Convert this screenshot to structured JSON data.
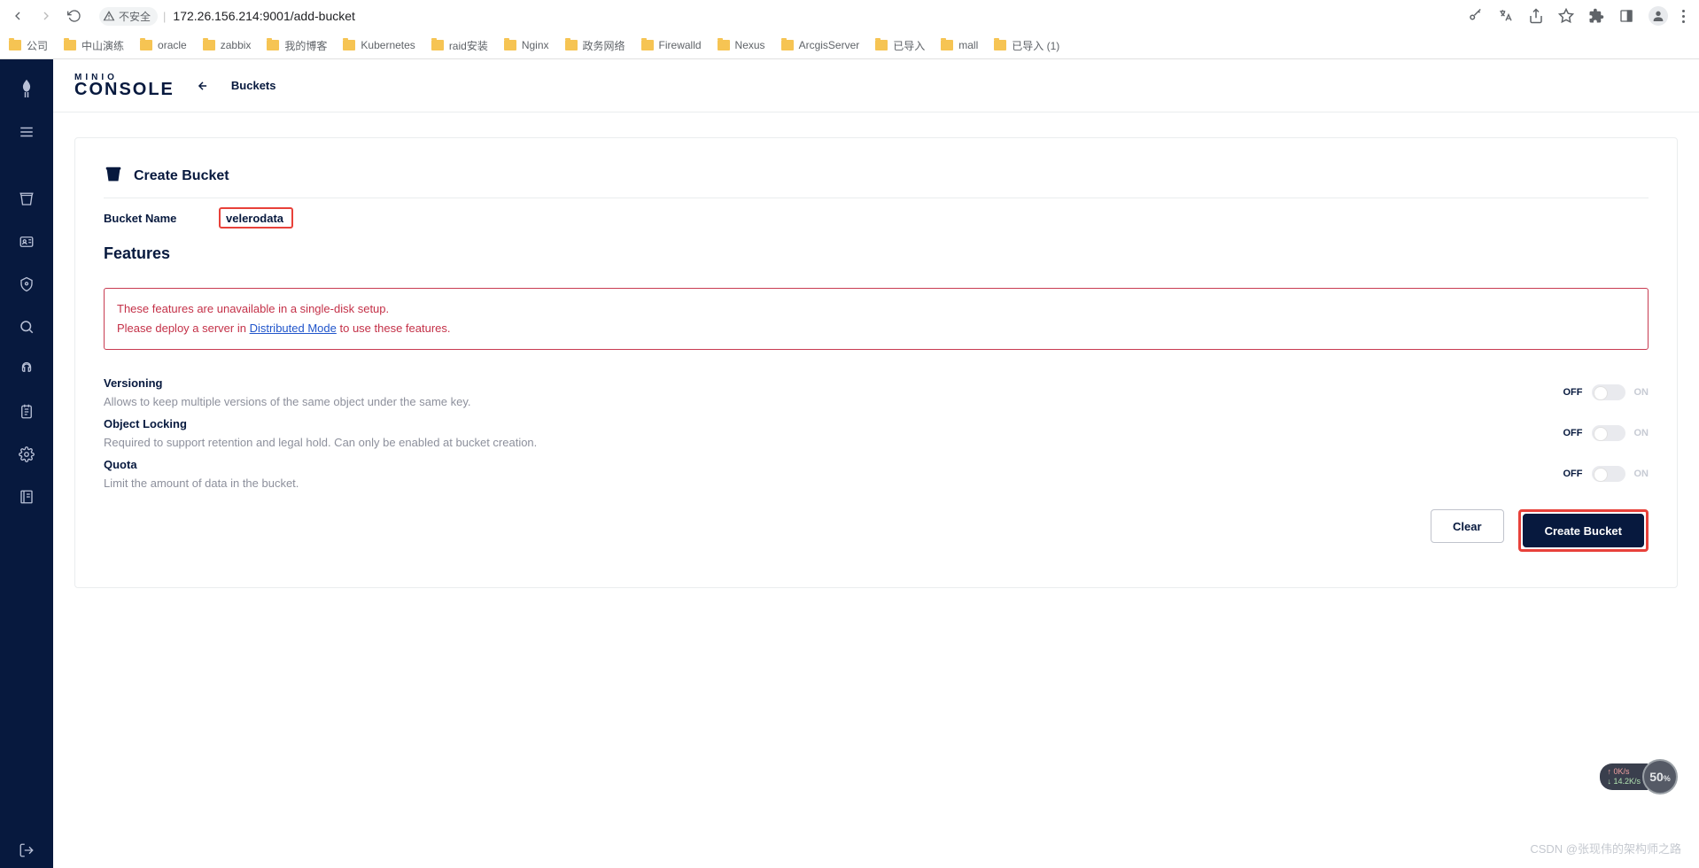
{
  "browser": {
    "insecure_label": "不安全",
    "url": "172.26.156.214:9001/add-bucket"
  },
  "bookmarks": [
    {
      "label": "公司"
    },
    {
      "label": "中山演练"
    },
    {
      "label": "oracle"
    },
    {
      "label": "zabbix"
    },
    {
      "label": "我的博客"
    },
    {
      "label": "Kubernetes"
    },
    {
      "label": "raid安装"
    },
    {
      "label": "Nginx"
    },
    {
      "label": "政务网络"
    },
    {
      "label": "Firewalld"
    },
    {
      "label": "Nexus"
    },
    {
      "label": "ArcgisServer"
    },
    {
      "label": "已导入"
    },
    {
      "label": "mall"
    },
    {
      "label": "已导入 (1)"
    }
  ],
  "brand": {
    "minio": "MINIO",
    "console": "CONSOLE"
  },
  "breadcrumb": {
    "buckets": "Buckets"
  },
  "page": {
    "title": "Create Bucket",
    "bucket_name_label": "Bucket Name",
    "bucket_name_value": "velerodata",
    "features_title": "Features",
    "warning_line1": "These features are unavailable in a single-disk setup.",
    "warning_line2_pre": "Please deploy a server in ",
    "warning_link": "Distributed Mode",
    "warning_line2_post": " to use these features."
  },
  "features": {
    "versioning": {
      "title": "Versioning",
      "desc": "Allows to keep multiple versions of the same object under the same key.",
      "off": "OFF",
      "on": "ON"
    },
    "locking": {
      "title": "Object Locking",
      "desc": "Required to support retention and legal hold. Can only be enabled at bucket creation.",
      "off": "OFF",
      "on": "ON"
    },
    "quota": {
      "title": "Quota",
      "desc": "Limit the amount of data in the bucket.",
      "off": "OFF",
      "on": "ON"
    }
  },
  "actions": {
    "clear": "Clear",
    "create": "Create Bucket"
  },
  "net_widget": {
    "up": "↑ 0K/s",
    "down": "↓ 14.2K/s",
    "pct": "50",
    "pct_suffix": "%"
  },
  "watermark": "CSDN @张现伟的架构师之路"
}
